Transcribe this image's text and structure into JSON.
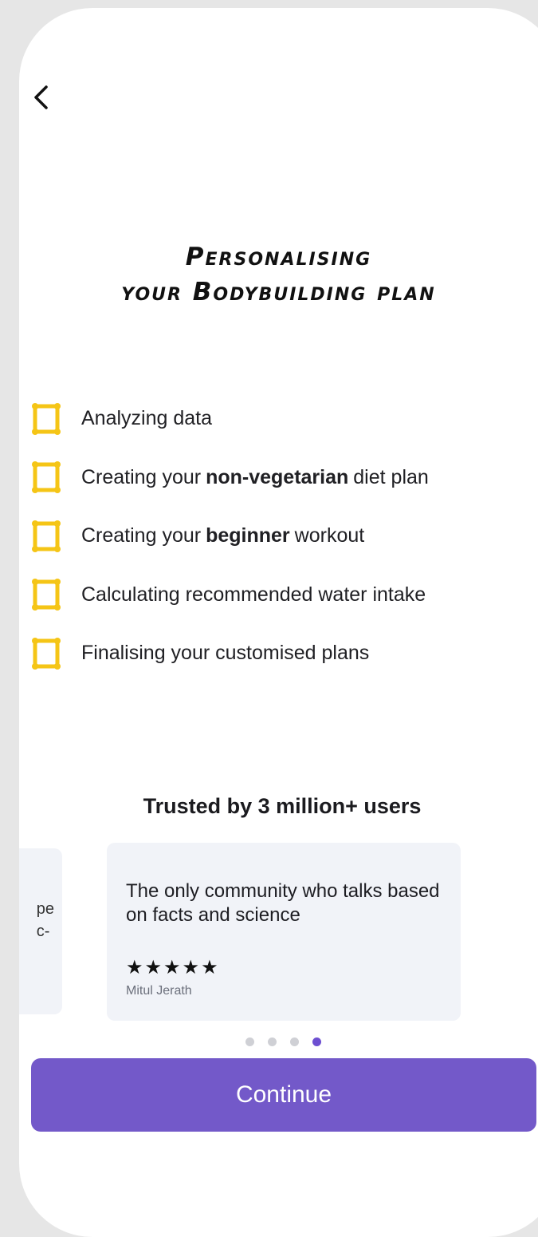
{
  "header": {
    "back_icon": "chevron-left-icon"
  },
  "title": {
    "line1": "Personalising",
    "line2": "your Bodybuilding plan"
  },
  "steps": [
    {
      "pre": "Analyzing data",
      "bold": "",
      "post": ""
    },
    {
      "pre": "Creating your",
      "bold": "non-vegetarian",
      "post": "diet plan"
    },
    {
      "pre": "Creating your",
      "bold": "beginner",
      "post": "workout"
    },
    {
      "pre": "Calculating recommended water intake",
      "bold": "",
      "post": ""
    },
    {
      "pre": "Finalising your customised plans",
      "bold": "",
      "post": ""
    }
  ],
  "step_icon": "loading-frame-icon",
  "step_icon_color": "#f5c516",
  "trusted": {
    "heading": "Trusted by 3 million+ users"
  },
  "reviews": {
    "partial_fragment_line1": "pe",
    "partial_fragment_line2": "c-",
    "current": {
      "quote": "The only community who talks based on facts and science",
      "stars": "★★★★★",
      "rating": 5,
      "author": "Mitul Jerath"
    },
    "page_index": 4,
    "page_count": 4
  },
  "actions": {
    "continue_label": "Continue"
  },
  "colors": {
    "accent": "#7359c9",
    "active_dot": "#6d4fd1",
    "card_bg": "#f1f3f8"
  }
}
